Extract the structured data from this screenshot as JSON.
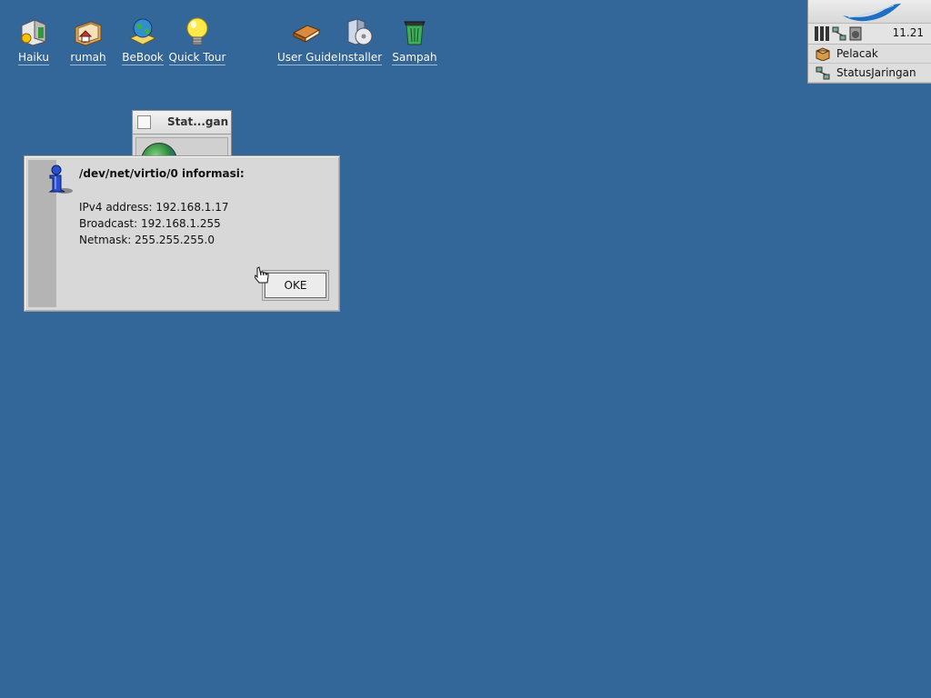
{
  "desktop": {
    "icons": [
      {
        "label": "Haiku",
        "icon": "haiku-disk-icon"
      },
      {
        "label": "rumah",
        "icon": "home-folder-icon"
      },
      {
        "label": "BeBook",
        "icon": "bebook-globe-icon"
      },
      {
        "label": "Quick Tour",
        "icon": "lightbulb-icon"
      },
      {
        "label": "User Guide",
        "icon": "book-icon"
      },
      {
        "label": "Installer",
        "icon": "installer-icon"
      },
      {
        "label": "Sampah",
        "icon": "trash-icon"
      }
    ]
  },
  "deskbar": {
    "clock": "11.21",
    "items": [
      {
        "label": "Pelacak",
        "icon": "tracker-icon"
      },
      {
        "label": "StatusJaringan",
        "icon": "network-status-icon"
      }
    ]
  },
  "background_window": {
    "title": "Stat...gan"
  },
  "alert": {
    "title": "/dev/net/virtio/0 informasi:",
    "lines": [
      "IPv4 address: 192.168.1.17",
      "Broadcast: 192.168.1.255",
      "Netmask: 255.255.255.0"
    ],
    "ok_label": "OKE"
  },
  "colors": {
    "desktop": "#336699",
    "panel": "#d8d8d8"
  }
}
